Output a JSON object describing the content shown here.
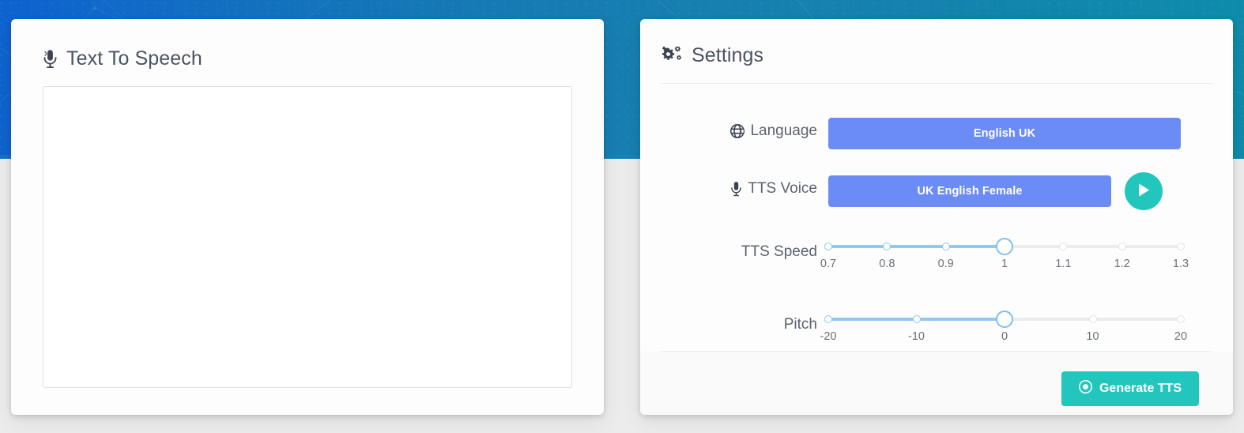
{
  "theme": {
    "banner_blue_left": "#0f63cf",
    "banner_blue_right": "#0e8cab",
    "page_background": "#ececec",
    "accent_purple": "#6c8cf5",
    "accent_teal": "#23c6bd",
    "slider_fill": "#90c9f0",
    "text_muted": "#5c6370"
  },
  "left_panel": {
    "title": "Text To Speech",
    "icon": "microphone-icon",
    "textarea": {
      "value": "",
      "placeholder": ""
    }
  },
  "right_panel": {
    "title": "Settings",
    "icon": "cogs-icon",
    "rows": {
      "language": {
        "label": "Language",
        "icon": "globe-icon",
        "selected": "English UK"
      },
      "voice": {
        "label": "TTS Voice",
        "icon": "microphone-icon",
        "selected": "UK English Female",
        "play_button_icon": "play-icon"
      },
      "speed": {
        "label": "TTS Speed",
        "ticks": [
          "0.7",
          "0.8",
          "0.9",
          "1",
          "1.1",
          "1.2",
          "1.3"
        ],
        "value": "1",
        "value_index": 3
      },
      "pitch": {
        "label": "Pitch",
        "ticks": [
          "-20",
          "-10",
          "0",
          "10",
          "20"
        ],
        "value": "0",
        "value_index": 2
      }
    },
    "footer": {
      "generate_label": "Generate TTS",
      "generate_icon": "dot-circle-icon"
    }
  }
}
